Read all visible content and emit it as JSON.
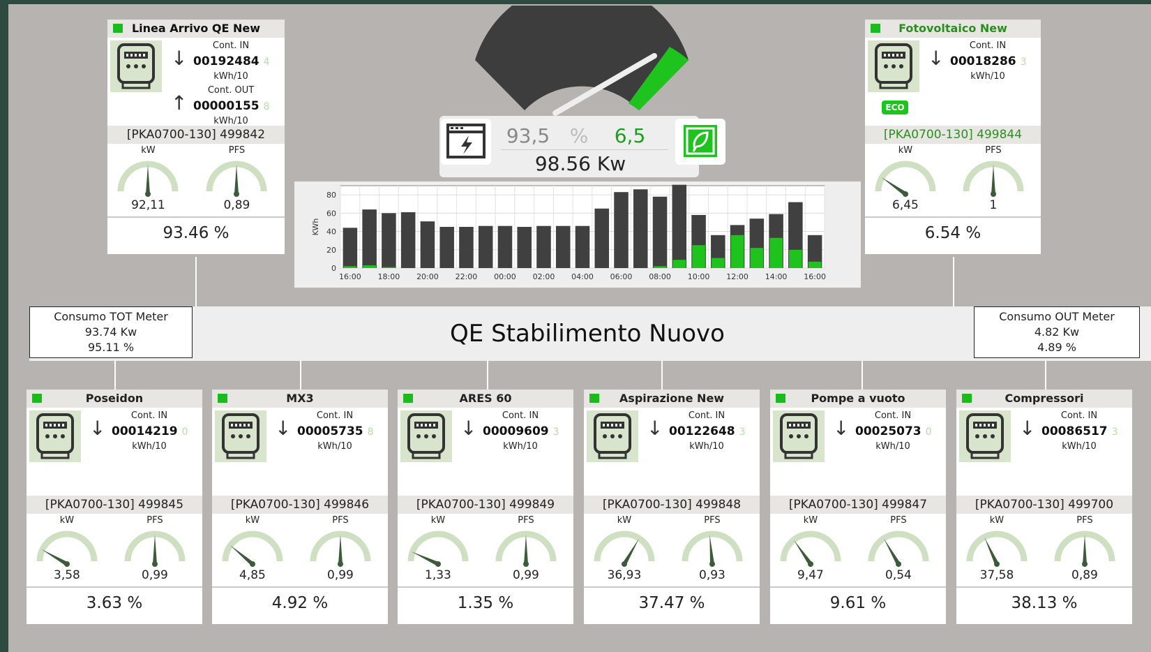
{
  "header": {
    "percent_left": "93,5",
    "percent_sign": "%",
    "percent_right": "6,5",
    "total_power": "98.56 Kw",
    "split_fraction_green": 0.065
  },
  "main_bus": {
    "title": "QE Stabilimento Nuovo",
    "left_box": {
      "title": "Consumo TOT Meter",
      "power": "93.74 Kw",
      "percent": "95.11 %"
    },
    "right_box": {
      "title": "Consumo OUT Meter",
      "power": "4.82 Kw",
      "percent": "4.89 %"
    }
  },
  "meters": [
    {
      "title": "Linea Arrivo QE New",
      "title_color": "#111111",
      "cont_in_label": "Cont. IN",
      "cont_in": "00192484",
      "cont_in_digit": "4",
      "unit_in": "kWh/10",
      "cont_out_label": "Cont. OUT",
      "cont_out": "00000155",
      "cont_out_digit": "8",
      "unit_out": "kWh/10",
      "id": "[PKA0700-130] 499842",
      "id_color": "#222222",
      "kw_label": "kW",
      "pfs_label": "PFS",
      "kw_value": "92,11",
      "pfs_value": "0,89",
      "kw_needle_deg": 0,
      "pfs_needle_deg": 0,
      "percent": "93.46 %"
    },
    {
      "title": "Fotovoltaico New",
      "title_color": "#2a8f1f",
      "cont_in_label": "Cont. IN",
      "cont_in": "00018286",
      "cont_in_digit": "3",
      "unit_in": "kWh/10",
      "badge": "ECO",
      "id": "[PKA0700-130] 499844",
      "id_color": "#2a8f1f",
      "kw_label": "kW",
      "pfs_label": "PFS",
      "kw_value": "6,45",
      "pfs_value": "1",
      "kw_needle_deg": -55,
      "pfs_needle_deg": 0,
      "percent": "6.54 %"
    },
    {
      "title": "Poseidon",
      "cont_in_label": "Cont. IN",
      "cont_in": "00014219",
      "cont_in_digit": "0",
      "unit_in": "kWh/10",
      "id": "[PKA0700-130] 499845",
      "kw_label": "kW",
      "pfs_label": "PFS",
      "kw_value": "3,58",
      "pfs_value": "0,99",
      "kw_needle_deg": -60,
      "pfs_needle_deg": 0,
      "percent": "3.63 %"
    },
    {
      "title": "MX3",
      "cont_in_label": "Cont. IN",
      "cont_in": "00005735",
      "cont_in_digit": "8",
      "unit_in": "kWh/10",
      "id": "[PKA0700-130] 499846",
      "kw_label": "kW",
      "pfs_label": "PFS",
      "kw_value": "4,85",
      "pfs_value": "0,99",
      "kw_needle_deg": -50,
      "pfs_needle_deg": 0,
      "percent": "4.92 %"
    },
    {
      "title": "ARES 60",
      "cont_in_label": "Cont. IN",
      "cont_in": "00009609",
      "cont_in_digit": "3",
      "unit_in": "kWh/10",
      "id": "[PKA0700-130] 499849",
      "kw_label": "kW",
      "pfs_label": "PFS",
      "kw_value": "1,33",
      "pfs_value": "0,99",
      "kw_needle_deg": -65,
      "pfs_needle_deg": 0,
      "percent": "1.35 %"
    },
    {
      "title": "Aspirazione New",
      "cont_in_label": "Cont. IN",
      "cont_in": "00122648",
      "cont_in_digit": "3",
      "unit_in": "kWh/10",
      "id": "[PKA0700-130] 499848",
      "kw_label": "kW",
      "pfs_label": "PFS",
      "kw_value": "36,93",
      "pfs_value": "0,93",
      "kw_needle_deg": 30,
      "pfs_needle_deg": -5,
      "percent": "37.47 %"
    },
    {
      "title": "Pompe a vuoto",
      "cont_in_label": "Cont. IN",
      "cont_in": "00025073",
      "cont_in_digit": "0",
      "unit_in": "kWh/10",
      "id": "[PKA0700-130] 499847",
      "kw_label": "kW",
      "pfs_label": "PFS",
      "kw_value": "9,47",
      "pfs_value": "0,54",
      "kw_needle_deg": -35,
      "pfs_needle_deg": -30,
      "percent": "9.61 %"
    },
    {
      "title": "Compressori",
      "cont_in_label": "Cont. IN",
      "cont_in": "00086517",
      "cont_in_digit": "3",
      "unit_in": "kWh/10",
      "id": "[PKA0700-130] 499700",
      "kw_label": "kW",
      "pfs_label": "PFS",
      "kw_value": "37,58",
      "pfs_value": "0,89",
      "kw_needle_deg": -25,
      "pfs_needle_deg": 0,
      "percent": "38.13 %"
    }
  ],
  "chart_data": {
    "type": "bar",
    "stacked": true,
    "ylabel": "KWh",
    "ylim": [
      0,
      90
    ],
    "yticks": [
      0,
      20,
      40,
      60,
      80
    ],
    "xtick_labels": [
      "16:00",
      "18:00",
      "20:00",
      "22:00",
      "00:00",
      "02:00",
      "04:00",
      "06:00",
      "08:00",
      "10:00",
      "12:00",
      "14:00",
      "16:00"
    ],
    "grid": true,
    "series": [
      {
        "color": "#404040",
        "values": [
          44,
          64,
          60,
          61,
          51,
          45,
          45,
          46,
          46,
          45,
          46,
          46,
          46,
          65,
          83,
          86,
          78,
          91,
          58,
          36,
          47,
          54,
          59,
          72,
          36
        ]
      },
      {
        "color": "#1ec31e",
        "values": [
          2,
          3,
          1,
          0,
          0,
          0,
          0,
          0,
          0,
          0,
          0,
          0,
          0,
          0,
          0,
          0,
          2,
          9,
          25,
          11,
          36,
          22,
          33,
          20,
          7
        ]
      }
    ]
  },
  "colors": {
    "green": "#1ec31e",
    "dark": "#404040",
    "background": "#b6b3b0"
  }
}
